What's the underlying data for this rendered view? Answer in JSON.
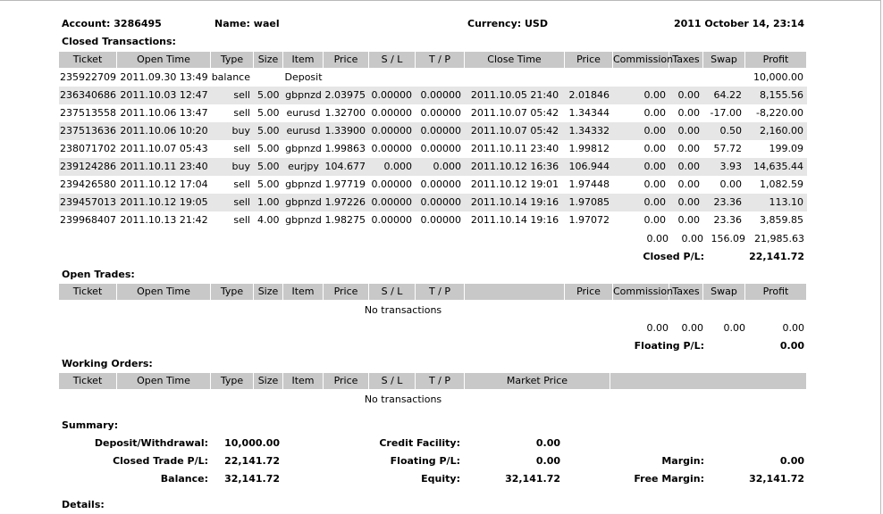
{
  "header": {
    "account": "Account: 3286495",
    "name": "Name: wael",
    "currency": "Currency: USD",
    "datetime": "2011 October 14, 23:14"
  },
  "closed": {
    "title": "Closed Transactions:",
    "columns": [
      "Ticket",
      "Open Time",
      "Type",
      "Size",
      "Item",
      "Price",
      "S / L",
      "T / P",
      "Close Time",
      "Price",
      "Commission",
      "Taxes",
      "Swap",
      "Profit"
    ],
    "rows": [
      {
        "ticket": "235922709",
        "open_time": "2011.09.30 13:49",
        "type": "balance",
        "size": "",
        "item": "Deposit",
        "price": "",
        "sl": "",
        "tp": "",
        "close_time": "",
        "close_price": "",
        "commission": "",
        "taxes": "",
        "swap": "",
        "profit": "10,000.00"
      },
      {
        "ticket": "236340686",
        "open_time": "2011.10.03 12:47",
        "type": "sell",
        "size": "5.00",
        "item": "gbpnzd",
        "price": "2.03975",
        "sl": "0.00000",
        "tp": "0.00000",
        "close_time": "2011.10.05 21:40",
        "close_price": "2.01846",
        "commission": "0.00",
        "taxes": "0.00",
        "swap": "64.22",
        "profit": "8,155.56"
      },
      {
        "ticket": "237513558",
        "open_time": "2011.10.06 13:47",
        "type": "sell",
        "size": "5.00",
        "item": "eurusd",
        "price": "1.32700",
        "sl": "0.00000",
        "tp": "0.00000",
        "close_time": "2011.10.07 05:42",
        "close_price": "1.34344",
        "commission": "0.00",
        "taxes": "0.00",
        "swap": "-17.00",
        "profit": "-8,220.00"
      },
      {
        "ticket": "237513636",
        "open_time": "2011.10.06 10:20",
        "type": "buy",
        "size": "5.00",
        "item": "eurusd",
        "price": "1.33900",
        "sl": "0.00000",
        "tp": "0.00000",
        "close_time": "2011.10.07 05:42",
        "close_price": "1.34332",
        "commission": "0.00",
        "taxes": "0.00",
        "swap": "0.50",
        "profit": "2,160.00"
      },
      {
        "ticket": "238071702",
        "open_time": "2011.10.07 05:43",
        "type": "sell",
        "size": "5.00",
        "item": "gbpnzd",
        "price": "1.99863",
        "sl": "0.00000",
        "tp": "0.00000",
        "close_time": "2011.10.11 23:40",
        "close_price": "1.99812",
        "commission": "0.00",
        "taxes": "0.00",
        "swap": "57.72",
        "profit": "199.09"
      },
      {
        "ticket": "239124286",
        "open_time": "2011.10.11 23:40",
        "type": "buy",
        "size": "5.00",
        "item": "eurjpy",
        "price": "104.677",
        "sl": "0.000",
        "tp": "0.000",
        "close_time": "2011.10.12 16:36",
        "close_price": "106.944",
        "commission": "0.00",
        "taxes": "0.00",
        "swap": "3.93",
        "profit": "14,635.44"
      },
      {
        "ticket": "239426580",
        "open_time": "2011.10.12 17:04",
        "type": "sell",
        "size": "5.00",
        "item": "gbpnzd",
        "price": "1.97719",
        "sl": "0.00000",
        "tp": "0.00000",
        "close_time": "2011.10.12 19:01",
        "close_price": "1.97448",
        "commission": "0.00",
        "taxes": "0.00",
        "swap": "0.00",
        "profit": "1,082.59"
      },
      {
        "ticket": "239457013",
        "open_time": "2011.10.12 19:05",
        "type": "sell",
        "size": "1.00",
        "item": "gbpnzd",
        "price": "1.97226",
        "sl": "0.00000",
        "tp": "0.00000",
        "close_time": "2011.10.14 19:16",
        "close_price": "1.97085",
        "commission": "0.00",
        "taxes": "0.00",
        "swap": "23.36",
        "profit": "113.10"
      },
      {
        "ticket": "239968407",
        "open_time": "2011.10.13 21:42",
        "type": "sell",
        "size": "4.00",
        "item": "gbpnzd",
        "price": "1.98275",
        "sl": "0.00000",
        "tp": "0.00000",
        "close_time": "2011.10.14 19:16",
        "close_price": "1.97072",
        "commission": "0.00",
        "taxes": "0.00",
        "swap": "23.36",
        "profit": "3,859.85"
      }
    ],
    "totals": {
      "commission": "0.00",
      "taxes": "0.00",
      "swap": "156.09",
      "profit": "21,985.63"
    },
    "pl_label": "Closed P/L:",
    "pl_value": "22,141.72"
  },
  "open": {
    "title": "Open Trades:",
    "columns": [
      "Ticket",
      "Open Time",
      "Type",
      "Size",
      "Item",
      "Price",
      "S / L",
      "T / P",
      "",
      "Price",
      "Commission",
      "Taxes",
      "Swap",
      "Profit"
    ],
    "empty": "No transactions",
    "totals": {
      "commission": "0.00",
      "taxes": "0.00",
      "swap": "0.00",
      "profit": "0.00"
    },
    "pl_label": "Floating P/L:",
    "pl_value": "0.00"
  },
  "working": {
    "title": "Working Orders:",
    "columns": [
      "Ticket",
      "Open Time",
      "Type",
      "Size",
      "Item",
      "Price",
      "S / L",
      "T / P",
      "Market Price",
      ""
    ],
    "empty": "No transactions"
  },
  "summary": {
    "title": "Summary:",
    "deposit_label": "Deposit/Withdrawal:",
    "deposit_value": "10,000.00",
    "closed_pl_label": "Closed Trade P/L:",
    "closed_pl_value": "22,141.72",
    "balance_label": "Balance:",
    "balance_value": "32,141.72",
    "credit_label": "Credit Facility:",
    "credit_value": "0.00",
    "floating_label": "Floating P/L:",
    "floating_value": "0.00",
    "equity_label": "Equity:",
    "equity_value": "32,141.72",
    "margin_label": "Margin:",
    "margin_value": "0.00",
    "free_margin_label": "Free Margin:",
    "free_margin_value": "32,141.72"
  },
  "details": {
    "title": "Details:"
  }
}
